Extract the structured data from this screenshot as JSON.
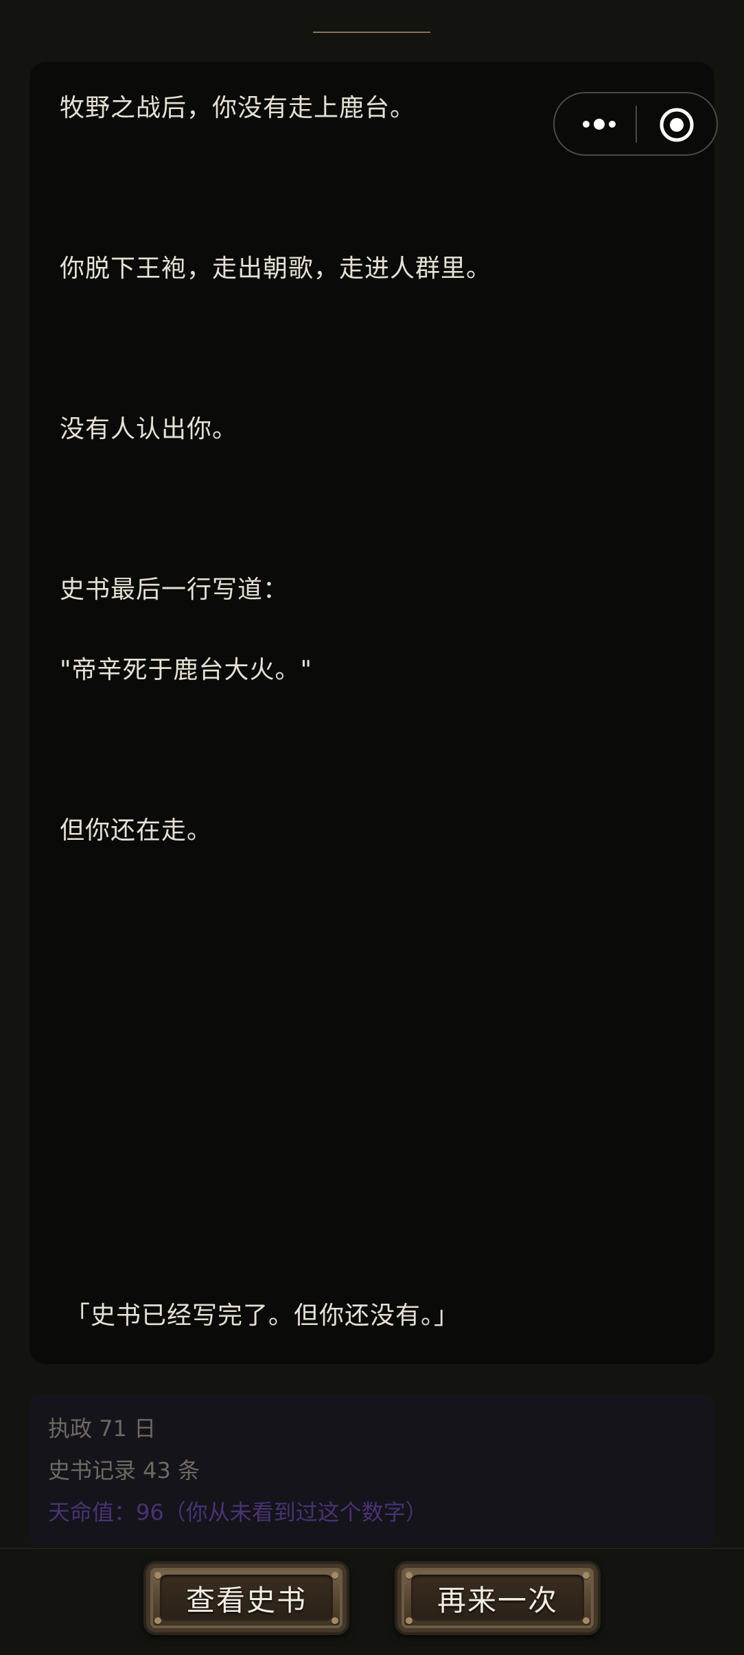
{
  "story": {
    "lines": [
      "牧野之战后，你没有走上鹿台。",
      "你脱下王袍，走出朝歌，走进人群里。",
      "没有人认出你。",
      "史书最后一行写道：",
      "\"帝辛死于鹿台大火。\"",
      "但你还在走。"
    ],
    "closing_quote": "「史书已经写完了。但你还没有。」"
  },
  "capsule": {
    "more_icon": "more-dots-icon",
    "close_icon": "target-close-icon"
  },
  "stats": {
    "days": "执政 71 日",
    "records": "史书记录 43 条",
    "fate": "天命值：96（你从未看到过这个数字）"
  },
  "actions": {
    "view_history_label": "查看史书",
    "retry_label": "再来一次"
  },
  "colors": {
    "background": "#131410",
    "card": "#0a0b08",
    "text": "#e6e1d4",
    "stat_text": "#6e6a63",
    "fate_text": "#4a3275",
    "divider": "#8a7456"
  }
}
